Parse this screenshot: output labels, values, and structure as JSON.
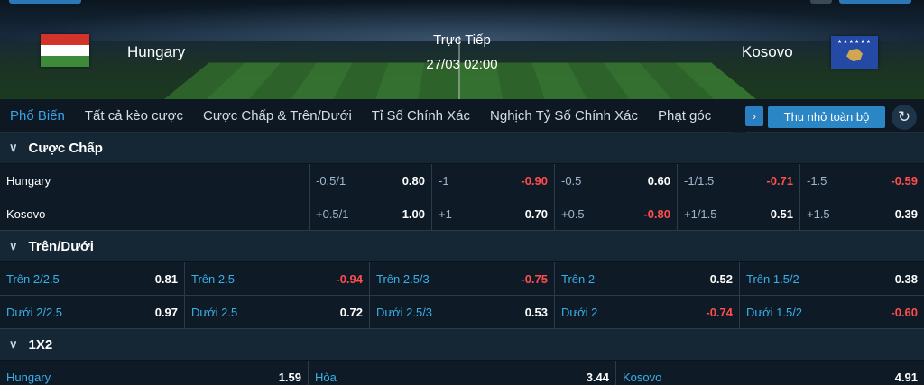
{
  "match": {
    "home_team": "Hungary",
    "away_team": "Kosovo",
    "status": "Trực Tiếp",
    "time": "27/03 02:00"
  },
  "tabs": [
    {
      "label": "Phổ Biến"
    },
    {
      "label": "Tất cả kèo cược"
    },
    {
      "label": "Cược Chấp & Trên/Dưới"
    },
    {
      "label": "Tỉ Số Chính Xác"
    },
    {
      "label": "Nghịch Tỷ Số Chính Xác"
    },
    {
      "label": "Phạt góc"
    }
  ],
  "toolbar": {
    "scroll_arrow": "›",
    "collapse_all": "Thu nhỏ toàn bộ",
    "refresh_icon": "↻"
  },
  "handicap": {
    "title": "Cược Chấp",
    "rows": [
      {
        "team": "Hungary",
        "cells": [
          {
            "label": "-0.5/1",
            "odd": "0.80",
            "neg": false
          },
          {
            "label": "-1",
            "odd": "-0.90",
            "neg": true
          },
          {
            "label": "-0.5",
            "odd": "0.60",
            "neg": false
          },
          {
            "label": "-1/1.5",
            "odd": "-0.71",
            "neg": true
          },
          {
            "label": "-1.5",
            "odd": "-0.59",
            "neg": true
          }
        ]
      },
      {
        "team": "Kosovo",
        "cells": [
          {
            "label": "+0.5/1",
            "odd": "1.00",
            "neg": false
          },
          {
            "label": "+1",
            "odd": "0.70",
            "neg": false
          },
          {
            "label": "+0.5",
            "odd": "-0.80",
            "neg": true
          },
          {
            "label": "+1/1.5",
            "odd": "0.51",
            "neg": false
          },
          {
            "label": "+1.5",
            "odd": "0.39",
            "neg": false
          }
        ]
      }
    ]
  },
  "over_under": {
    "title": "Trên/Dưới",
    "rows": [
      {
        "cells": [
          {
            "label": "Trên 2/2.5",
            "odd": "0.81",
            "neg": false
          },
          {
            "label": "Trên 2.5",
            "odd": "-0.94",
            "neg": true
          },
          {
            "label": "Trên 2.5/3",
            "odd": "-0.75",
            "neg": true
          },
          {
            "label": "Trên 2",
            "odd": "0.52",
            "neg": false
          },
          {
            "label": "Trên 1.5/2",
            "odd": "0.38",
            "neg": false
          }
        ]
      },
      {
        "cells": [
          {
            "label": "Dưới 2/2.5",
            "odd": "0.97",
            "neg": false
          },
          {
            "label": "Dưới 2.5",
            "odd": "0.72",
            "neg": false
          },
          {
            "label": "Dưới 2.5/3",
            "odd": "0.53",
            "neg": false
          },
          {
            "label": "Dưới 2",
            "odd": "-0.74",
            "neg": true
          },
          {
            "label": "Dưới 1.5/2",
            "odd": "-0.60",
            "neg": true
          }
        ]
      }
    ]
  },
  "one_x_two": {
    "title": "1X2",
    "cells": [
      {
        "label": "Hungary",
        "odd": "1.59"
      },
      {
        "label": "Hòa",
        "odd": "3.44"
      },
      {
        "label": "Kosovo",
        "odd": "4.91"
      }
    ]
  },
  "colors": {
    "accent": "#3aa3e8",
    "negative": "#ff4d4d",
    "button": "#2a86c4"
  }
}
